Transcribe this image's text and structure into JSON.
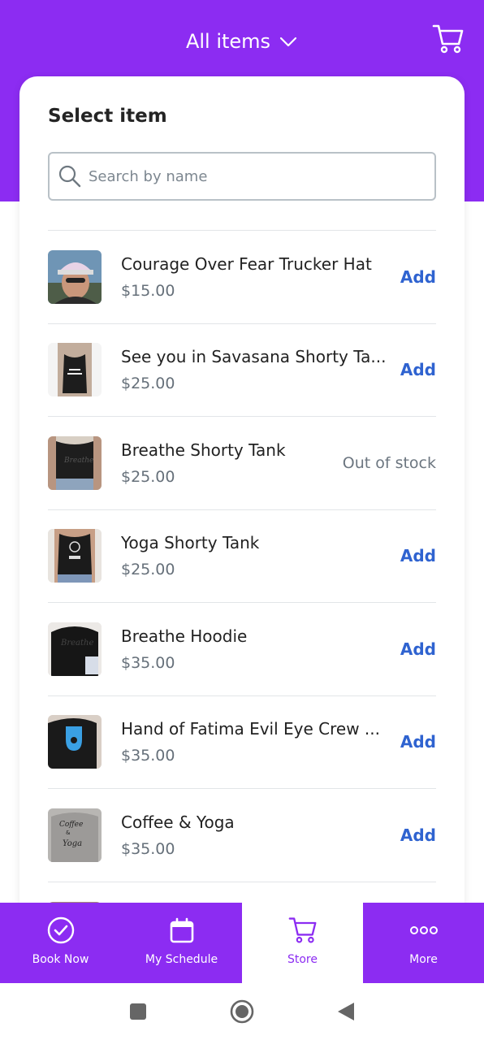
{
  "header": {
    "title": "All items",
    "brand_color": "#8c2cf2"
  },
  "card": {
    "title": "Select item"
  },
  "search": {
    "placeholder": "Search by name"
  },
  "items": [
    {
      "name": "Courage Over Fear Trucker Hat",
      "price": "$15.00",
      "action": "Add",
      "in_stock": true
    },
    {
      "name": "See you in Savasana Shorty Ta...",
      "price": "$25.00",
      "action": "Add",
      "in_stock": true
    },
    {
      "name": "Breathe Shorty Tank",
      "price": "$25.00",
      "action": "Out of stock",
      "in_stock": false
    },
    {
      "name": "Yoga Shorty Tank",
      "price": "$25.00",
      "action": "Add",
      "in_stock": true
    },
    {
      "name": "Breathe Hoodie",
      "price": "$35.00",
      "action": "Add",
      "in_stock": true
    },
    {
      "name": "Hand of Fatima Evil Eye Crew ...",
      "price": "$35.00",
      "action": "Add",
      "in_stock": true
    },
    {
      "name": "Coffee & Yoga",
      "price": "$35.00",
      "action": "Add",
      "in_stock": true
    }
  ],
  "tabs": [
    {
      "label": "Book Now",
      "icon": "check-circle-icon",
      "active": false
    },
    {
      "label": "My Schedule",
      "icon": "calendar-icon",
      "active": false
    },
    {
      "label": "Store",
      "icon": "cart-icon",
      "active": true
    },
    {
      "label": "More",
      "icon": "more-dots-icon",
      "active": false
    }
  ],
  "system_nav": [
    "recents-button",
    "home-button",
    "back-button"
  ]
}
